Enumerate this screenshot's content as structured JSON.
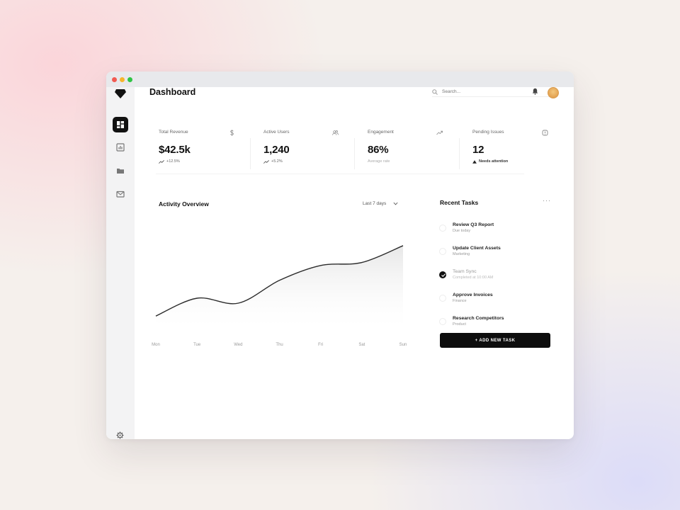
{
  "window": {
    "controls": [
      "close",
      "minimize",
      "maximize"
    ]
  },
  "sidebar": {
    "logo_icon": "pentagon-logo-icon",
    "items": [
      {
        "icon": "dashboard-grid-icon",
        "active": true
      },
      {
        "icon": "chart-icon",
        "active": false
      },
      {
        "icon": "folder-icon",
        "active": false
      },
      {
        "icon": "mail-icon",
        "active": false
      }
    ],
    "settings_icon": "gear-icon"
  },
  "header": {
    "title": "Dashboard",
    "search_placeholder": "Search...",
    "notification_icon": "bell-icon",
    "avatar_icon": "avatar"
  },
  "stats": [
    {
      "label": "Total Revenue",
      "value": "$42.5k",
      "sub": "+12.5%",
      "icon": "dollar-icon"
    },
    {
      "label": "Active Users",
      "value": "1,240",
      "sub": "+5.2%",
      "icon": "users-icon"
    },
    {
      "label": "Engagement",
      "value": "86%",
      "sub": "Average rate",
      "icon": "trend-icon"
    },
    {
      "label": "Pending Issues",
      "value": "12",
      "sub": "Needs attention",
      "icon": "alert-icon"
    }
  ],
  "activity": {
    "title": "Activity Overview",
    "range": "Last 7 days"
  },
  "chart_data": {
    "type": "area",
    "title": "Activity Overview",
    "categories": [
      "Mon",
      "Tue",
      "Wed",
      "Thu",
      "Fri",
      "Sat",
      "Sun"
    ],
    "values": [
      12,
      30,
      25,
      48,
      63,
      66,
      83
    ],
    "ylim": [
      0,
      100
    ],
    "grid": false,
    "legend": "none"
  },
  "tasks": {
    "title": "Recent Tasks",
    "more": "···",
    "items": [
      {
        "title": "Review Q3 Report",
        "sub": "Due today",
        "done": false
      },
      {
        "title": "Update Client Assets",
        "sub": "Marketing",
        "done": false
      },
      {
        "title": "Team Sync",
        "sub": "Completed at 10:00 AM",
        "done": true
      },
      {
        "title": "Approve Invoices",
        "sub": "Finance",
        "done": false
      },
      {
        "title": "Research Competitors",
        "sub": "Product",
        "done": false
      }
    ],
    "add_label": "+ ADD NEW TASK"
  },
  "colors": {
    "accent": "#111111",
    "sidebar_bg": "#f3f3f4",
    "titlebar_bg": "#e8e9ec",
    "close": "#f25a52",
    "minimize": "#f6b52d",
    "maximize": "#2fc445"
  }
}
